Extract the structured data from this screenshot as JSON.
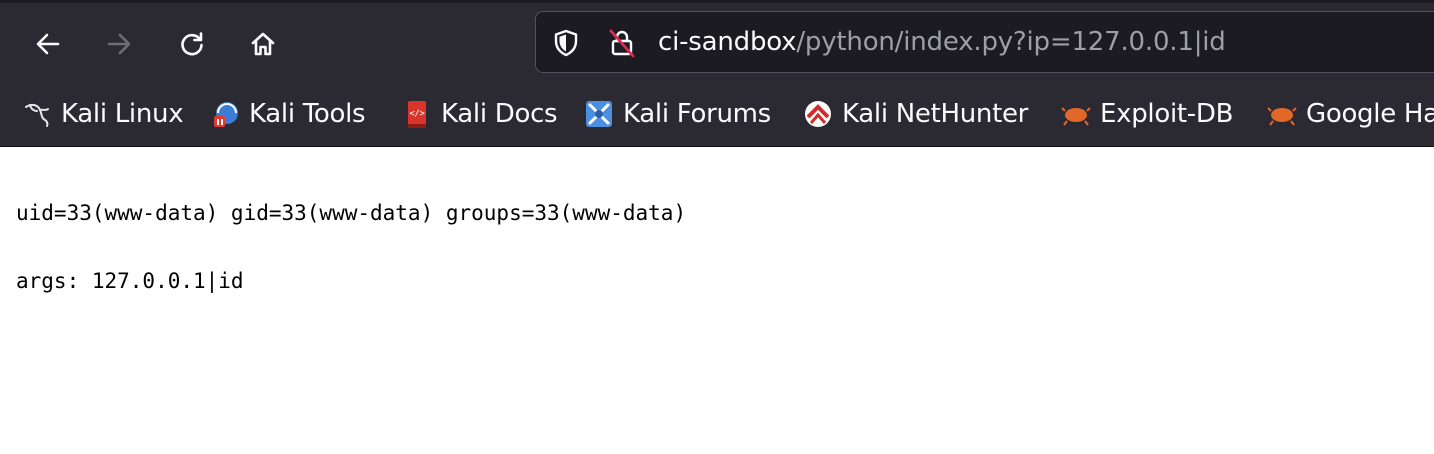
{
  "toolbar": {
    "back_icon": "arrow-left-icon",
    "forward_icon": "arrow-right-icon",
    "reload_icon": "reload-icon",
    "home_icon": "home-icon"
  },
  "urlbar": {
    "host": "ci-sandbox",
    "path": "/python/index.py?ip=127.0.0.1|id"
  },
  "bookmarks": [
    {
      "label": "Kali Linux",
      "icon": "kali-dragon-icon"
    },
    {
      "label": "Kali Tools",
      "icon": "kali-tools-icon"
    },
    {
      "label": "Kali Docs",
      "icon": "kali-docs-icon"
    },
    {
      "label": "Kali Forums",
      "icon": "kali-forums-icon"
    },
    {
      "label": "Kali NetHunter",
      "icon": "nethunter-icon"
    },
    {
      "label": "Exploit-DB",
      "icon": "exploit-db-icon"
    },
    {
      "label": "Google Ha",
      "icon": "ghdb-icon"
    }
  ],
  "page": {
    "line1": "uid=33(www-data) gid=33(www-data) groups=33(www-data)",
    "line2": "args: 127.0.0.1|id"
  },
  "colors": {
    "chrome": "#2b2a33",
    "urlbar": "#1c1b22",
    "text_light": "#fbfbfe",
    "text_muted": "#9e9ea6",
    "slash_red": "#e22850"
  }
}
